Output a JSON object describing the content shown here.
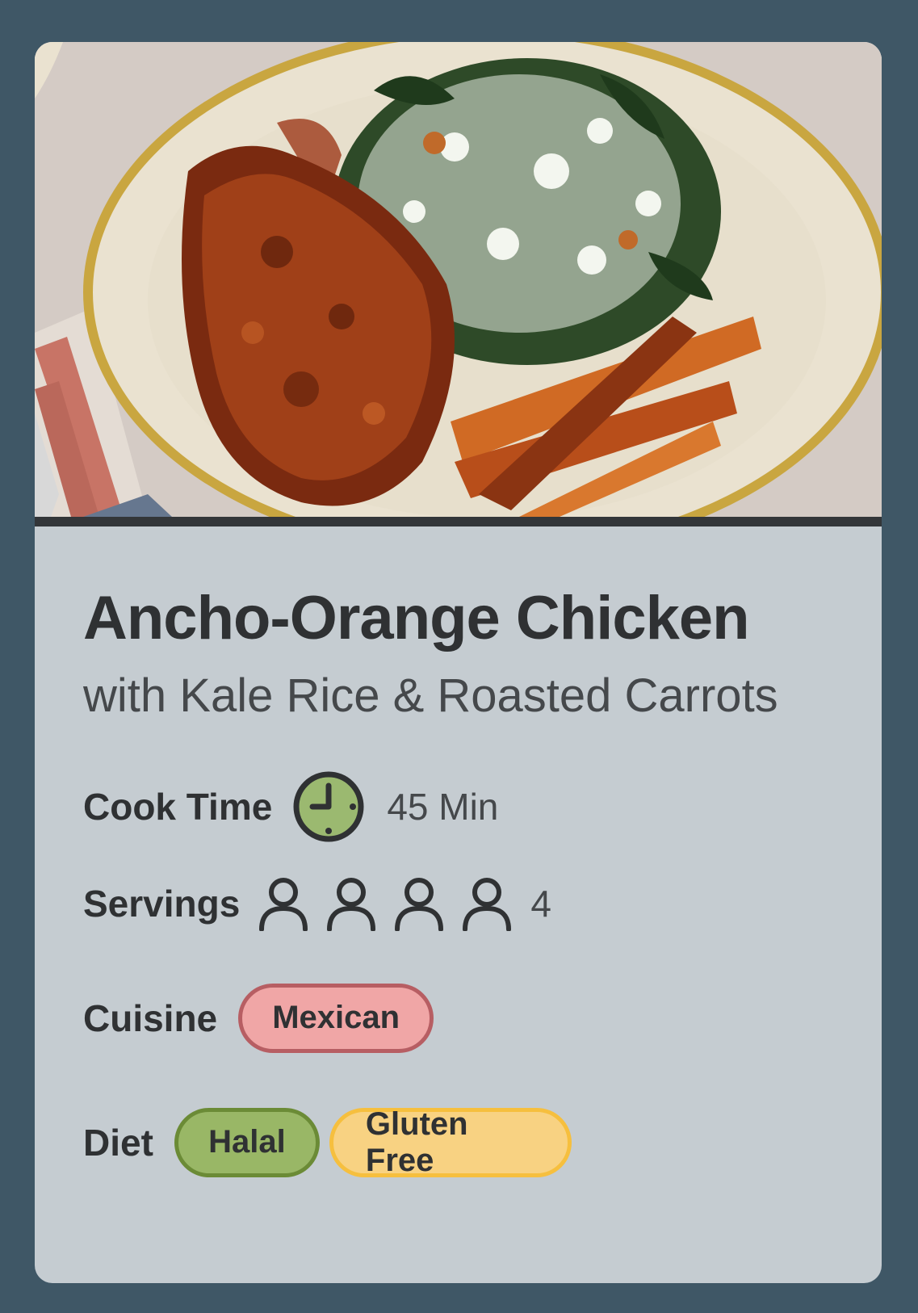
{
  "recipe": {
    "title": "Ancho-Orange Chicken",
    "subtitle": "with Kale Rice & Roasted Carrots",
    "cook_time": {
      "label": "Cook Time",
      "value": "45 Min",
      "icon": "clock-icon"
    },
    "servings": {
      "label": "Servings",
      "value": "4",
      "count": 4,
      "icon": "person-icon"
    },
    "cuisine": {
      "label": "Cuisine",
      "tags": [
        "Mexican"
      ]
    },
    "diet": {
      "label": "Diet",
      "tags": [
        "Halal",
        "Gluten Free"
      ]
    }
  },
  "colors": {
    "background": "#3f5766",
    "card": "#c5ccd1",
    "text": "#2f3133",
    "mexican_fill": "#f0a6a6",
    "mexican_border": "#b75e63",
    "halal_fill": "#99b766",
    "halal_border": "#6b8b36",
    "gluten_free_fill": "#f8d282",
    "gluten_free_border": "#f6bf3e",
    "clock_fill": "#9bb970"
  }
}
